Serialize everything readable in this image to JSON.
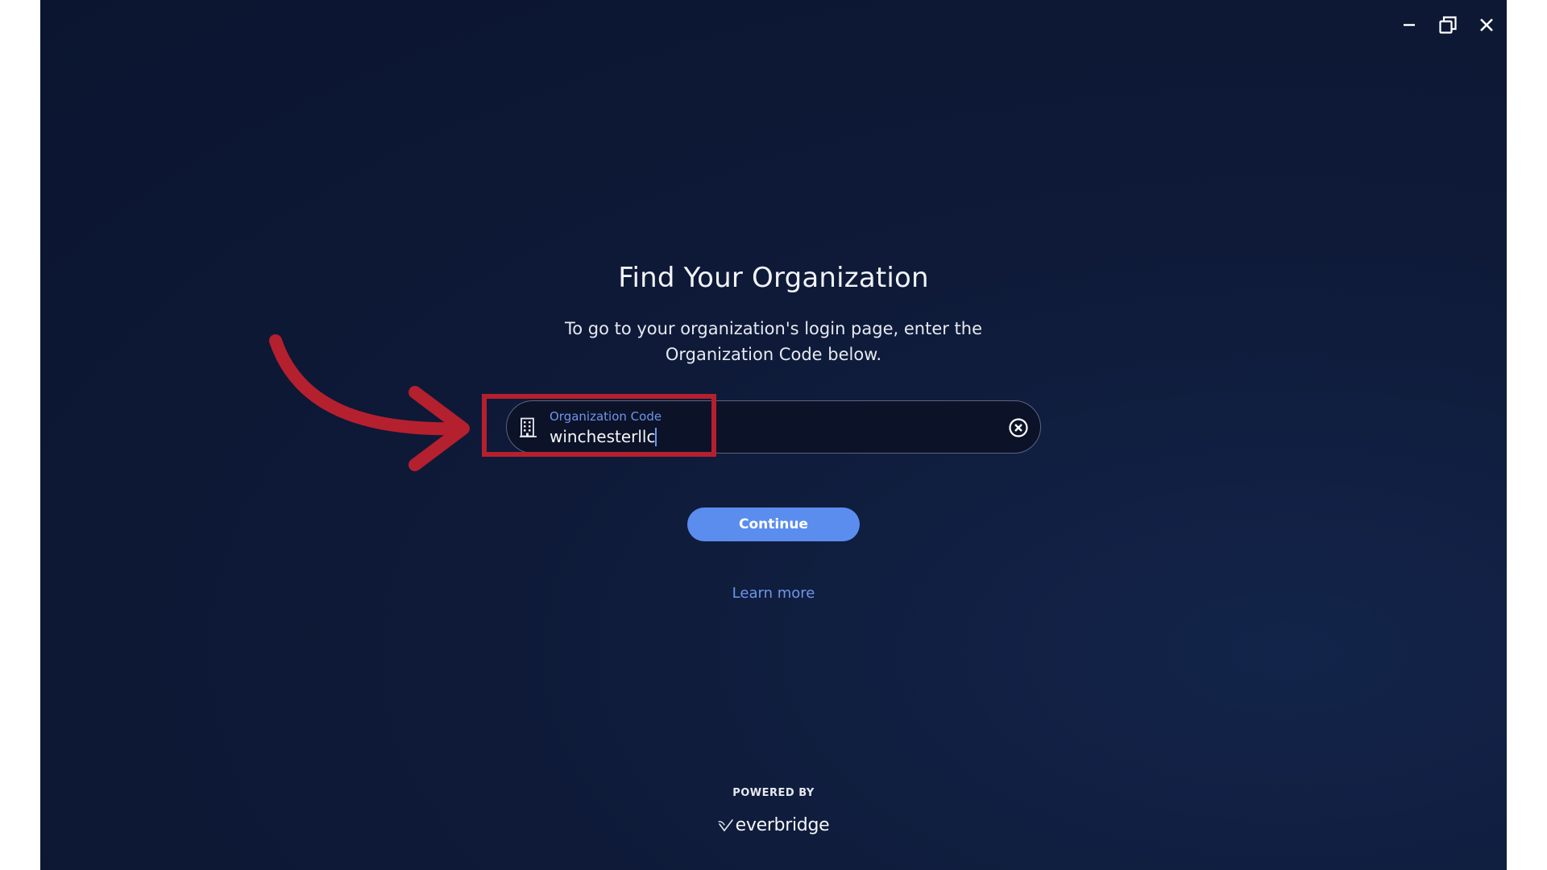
{
  "window": {
    "controls": [
      "minimize",
      "restore",
      "close"
    ]
  },
  "page": {
    "title": "Find Your Organization",
    "subtitle": "To go to your organization's login page, enter the Organization Code below."
  },
  "org_field": {
    "label": "Organization Code",
    "value": "winchesterllc",
    "icon": "building-icon",
    "clear_icon": "clear-circle-icon"
  },
  "actions": {
    "continue_label": "Continue",
    "learn_more_label": "Learn more"
  },
  "footer": {
    "powered_by": "POWERED BY",
    "brand": "everbridge"
  },
  "colors": {
    "background": "#0e1a38",
    "accent": "#5b8def",
    "label": "#6f95ea",
    "annotation": "#b5202e"
  }
}
